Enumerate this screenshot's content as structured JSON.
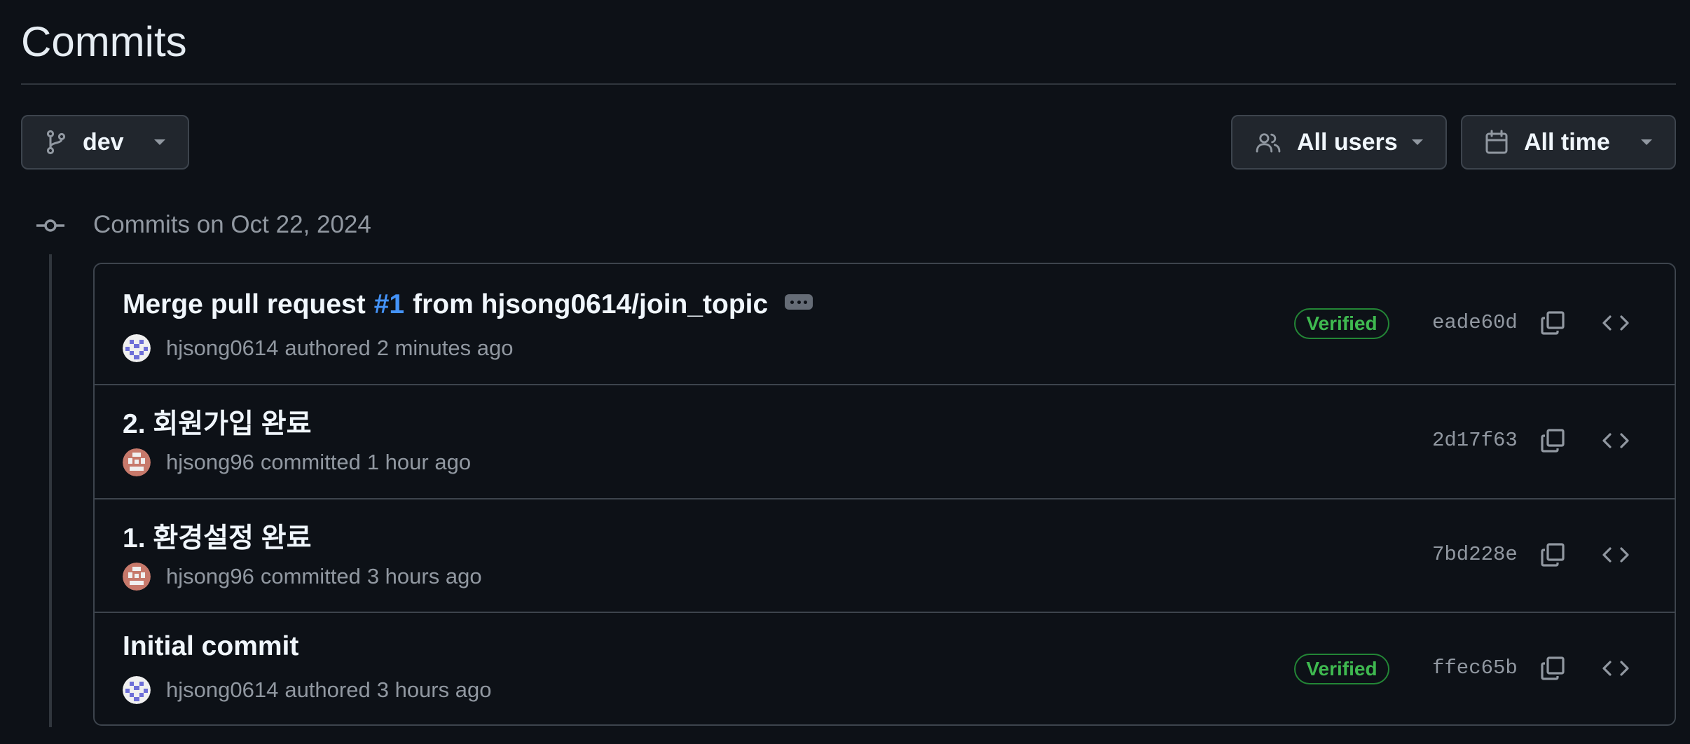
{
  "page": {
    "title": "Commits"
  },
  "filters": {
    "branch": "dev",
    "users": "All users",
    "time": "All time"
  },
  "day_group": {
    "heading": "Commits on Oct 22, 2024"
  },
  "commits": [
    {
      "message_prefix": "Merge pull request",
      "pr_ref": "#1",
      "message_suffix": "from hjsong0614/join_topic",
      "author": "hjsong0614",
      "verb": "authored",
      "time": "2 minutes ago",
      "verified": "Verified",
      "sha": "eade60d"
    },
    {
      "message": "2. 회원가입 완료",
      "author": "hjsong96",
      "verb": "committed",
      "time": "1 hour ago",
      "sha": "2d17f63"
    },
    {
      "message": "1. 환경설정 완료",
      "author": "hjsong96",
      "verb": "committed",
      "time": "3 hours ago",
      "sha": "7bd228e"
    },
    {
      "message": "Initial commit",
      "author": "hjsong0614",
      "verb": "authored",
      "time": "3 hours ago",
      "verified": "Verified",
      "sha": "ffec65b"
    }
  ],
  "icons": {
    "branch": "git-branch-icon",
    "users": "people-icon",
    "calendar": "calendar-icon",
    "caret": "triangle-down-icon",
    "commit": "git-commit-icon",
    "copy": "copy-icon",
    "browse": "code-icon",
    "ellipsis": "kebab-horizontal-icon"
  },
  "colors": {
    "background": "#0d1117",
    "button_bg": "#21262d",
    "border": "#3d444d",
    "muted_text": "#9198a1",
    "link": "#4493f8",
    "verified": "#3fb950",
    "avatar_blue": "#6e6fd8",
    "avatar_red": "#c7796b"
  }
}
